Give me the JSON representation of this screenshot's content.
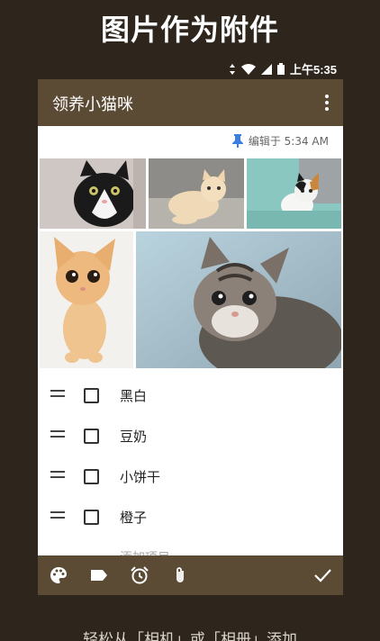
{
  "headline": "图片作为附件",
  "status": {
    "time": "上午5:35"
  },
  "note": {
    "title": "领养小猫咪",
    "edited": "编辑于 5:34 AM",
    "checklist": [
      {
        "label": "黑白",
        "checked": false
      },
      {
        "label": "豆奶",
        "checked": false
      },
      {
        "label": "小饼干",
        "checked": false
      },
      {
        "label": "橙子",
        "checked": false
      }
    ],
    "add_item_placeholder": "添加项目"
  },
  "bottom_icons": [
    "palette-icon",
    "label-icon",
    "alarm-icon",
    "attachment-icon",
    "done-check-icon"
  ],
  "caption": "轻松从「相机」或「相册」添加"
}
